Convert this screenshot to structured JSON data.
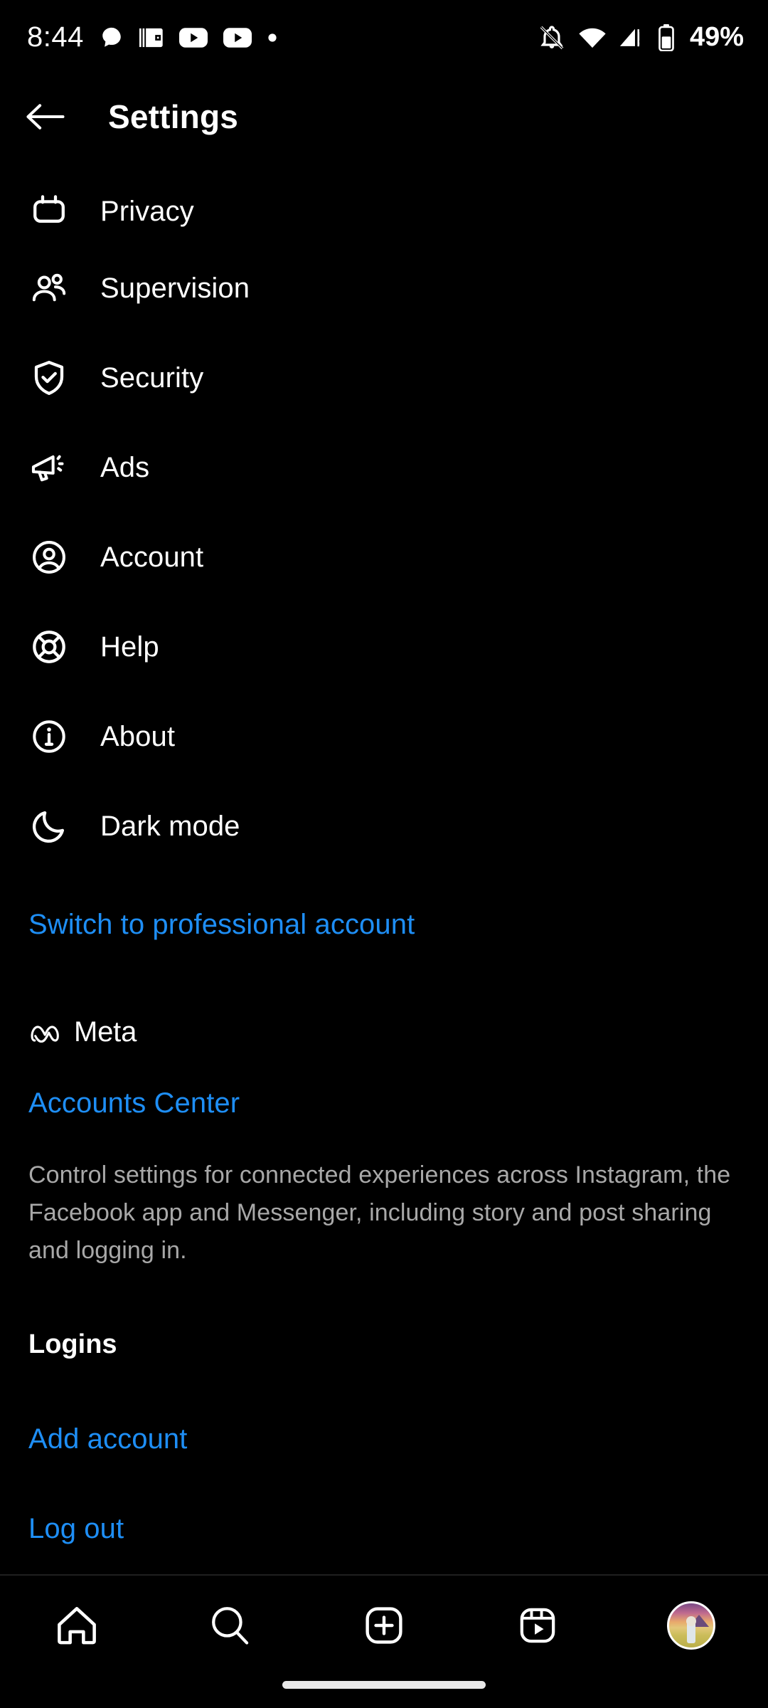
{
  "status_bar": {
    "time": "8:44",
    "battery_percent": "49%",
    "left_icons": [
      "chat-bubble-icon",
      "wallet-icon",
      "youtube-icon",
      "youtube-icon",
      "dot-icon"
    ],
    "right_icons": [
      "bell-off-icon",
      "wifi-icon",
      "cellular-signal-warning-icon",
      "battery-icon"
    ]
  },
  "header": {
    "back_icon": "arrow-left-icon",
    "title": "Settings"
  },
  "settings": {
    "items": [
      {
        "label": "Privacy",
        "icon": "lock-icon"
      },
      {
        "label": "Supervision",
        "icon": "people-icon"
      },
      {
        "label": "Security",
        "icon": "shield-check-icon"
      },
      {
        "label": "Ads",
        "icon": "megaphone-icon"
      },
      {
        "label": "Account",
        "icon": "person-circle-icon"
      },
      {
        "label": "Help",
        "icon": "life-ring-icon"
      },
      {
        "label": "About",
        "icon": "info-circle-icon"
      },
      {
        "label": "Dark mode",
        "icon": "moon-icon"
      }
    ],
    "switch_professional": "Switch to professional account"
  },
  "meta_section": {
    "logo_icon": "meta-infinity-icon",
    "brand": "Meta",
    "accounts_center": "Accounts Center",
    "description": "Control settings for connected experiences across Instagram, the Facebook app and Messenger, including story and post sharing and logging in."
  },
  "logins_section": {
    "title": "Logins",
    "add_account": "Add account",
    "log_out": "Log out"
  },
  "bottom_nav": {
    "items": [
      {
        "name": "home-icon"
      },
      {
        "name": "search-icon"
      },
      {
        "name": "create-icon"
      },
      {
        "name": "reels-icon"
      },
      {
        "name": "profile-avatar"
      }
    ]
  },
  "colors": {
    "background": "#000000",
    "text_primary": "#ffffff",
    "text_secondary": "#a8a8a8",
    "link_blue": "#1e8ef5"
  }
}
